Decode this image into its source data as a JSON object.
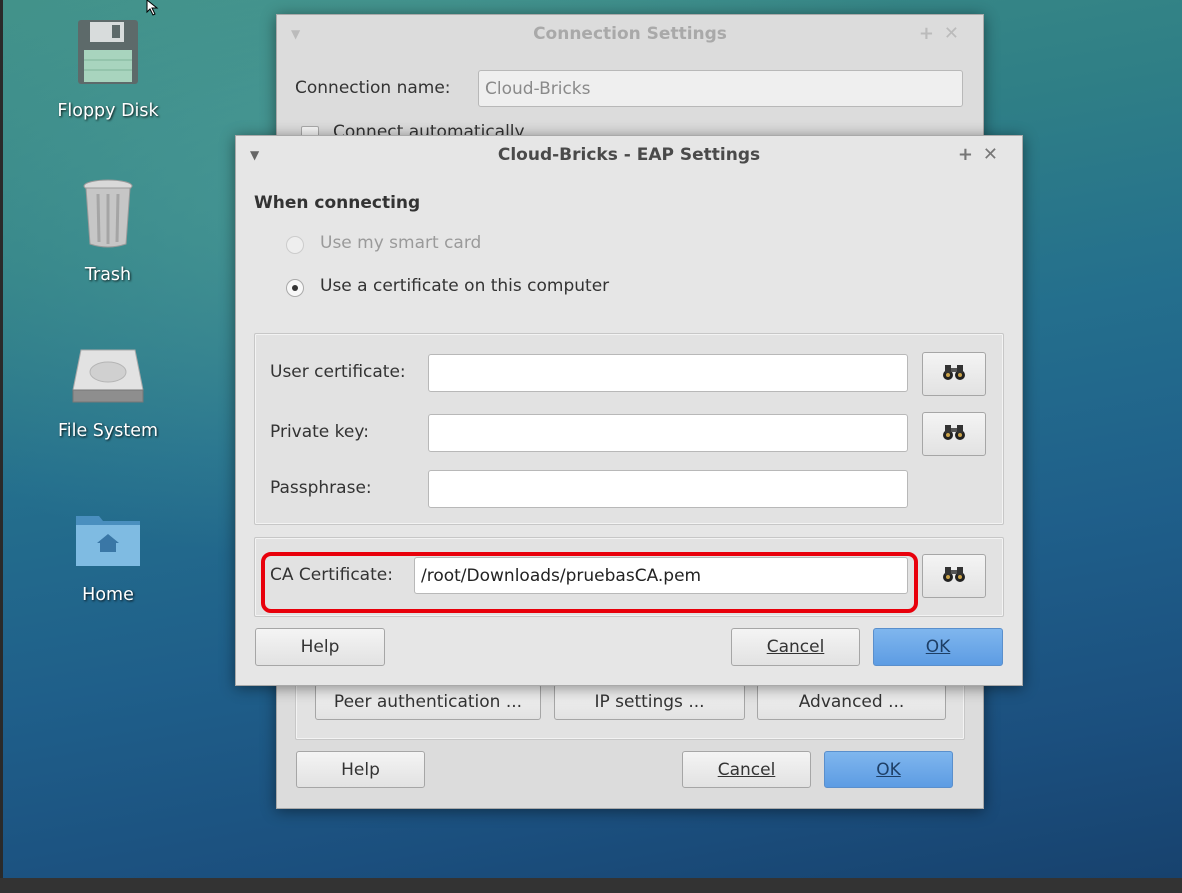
{
  "desktop": {
    "icons": [
      {
        "label": "Floppy Disk",
        "icon": "floppy-disk-icon"
      },
      {
        "label": "Trash",
        "icon": "trash-icon"
      },
      {
        "label": "File System",
        "icon": "hard-drive-icon"
      },
      {
        "label": "Home",
        "icon": "home-folder-icon"
      }
    ]
  },
  "connection_window": {
    "title": "Connection Settings",
    "connection_name_label": "Connection name:",
    "connection_name_value": "Cloud-Bricks",
    "connect_automatically_label": "Connect automatically",
    "peer_auth_label": "Peer authentication ...",
    "ip_settings_label": "IP settings ...",
    "advanced_label": "Advanced ...",
    "help_label": "Help",
    "cancel_label": "Cancel",
    "ok_label": "OK"
  },
  "eap_window": {
    "title": "Cloud-Bricks - EAP Settings",
    "section_heading": "When connecting",
    "radio_smart_card": "Use my smart card",
    "radio_certificate": "Use a certificate on this computer",
    "user_cert_label": "User certificate:",
    "user_cert_value": "",
    "private_key_label": "Private key:",
    "private_key_value": "",
    "passphrase_label": "Passphrase:",
    "passphrase_value": "",
    "ca_cert_label": "CA Certificate:",
    "ca_cert_value": "/root/Downloads/pruebasCA.pem",
    "help_label": "Help",
    "cancel_label": "Cancel",
    "ok_label": "OK"
  },
  "colors": {
    "highlight": "#e8000b",
    "primary_button": "#6aa6e8"
  }
}
